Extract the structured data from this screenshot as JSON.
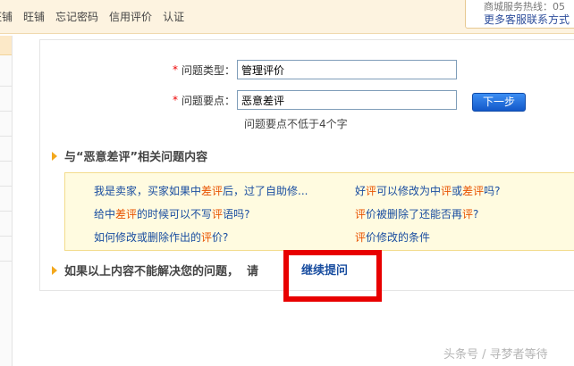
{
  "topnav": [
    "旺铺",
    "旺铺",
    "忘记密码",
    "信用评价",
    "认证"
  ],
  "hotline": {
    "text": "商城服务热线：05",
    "more": "更多客服联系方式 ›"
  },
  "form": {
    "type_label": "问题类型：",
    "type_value": "管理评价",
    "point_label": "问题要点：",
    "point_value": "恶意差评",
    "next_button": "下一步",
    "hint": "问题要点不低于4个字"
  },
  "related": {
    "title": "与“恶意差评”相关问题内容",
    "links": [
      {
        "parts": [
          "我是卖家，买家如果中",
          "差评",
          "后，过了自助修..."
        ]
      },
      {
        "parts": [
          "好",
          "评",
          "可以修改为中",
          "评",
          "或",
          "差评",
          "吗?"
        ]
      },
      {
        "parts": [
          "给中",
          "差评",
          "的时候可以不写",
          "评",
          "语吗?"
        ]
      },
      {
        "parts": [
          "",
          "评",
          "价被删除了还能否再",
          "评",
          "?"
        ]
      },
      {
        "parts": [
          "如何修改或删除作出的",
          "评",
          "价?"
        ]
      },
      {
        "parts": [
          "",
          "评",
          "价修改的条件"
        ]
      }
    ]
  },
  "unresolved": {
    "text": "如果以上内容不能解决您的问题，  请",
    "link": "继续提问"
  },
  "watermark": "头条号 / 寻梦者等待",
  "colors": {
    "accent_link": "#1a4ea0",
    "highlight": "#e85300",
    "button": "#1358c9",
    "annotation_box": "#e80000"
  }
}
